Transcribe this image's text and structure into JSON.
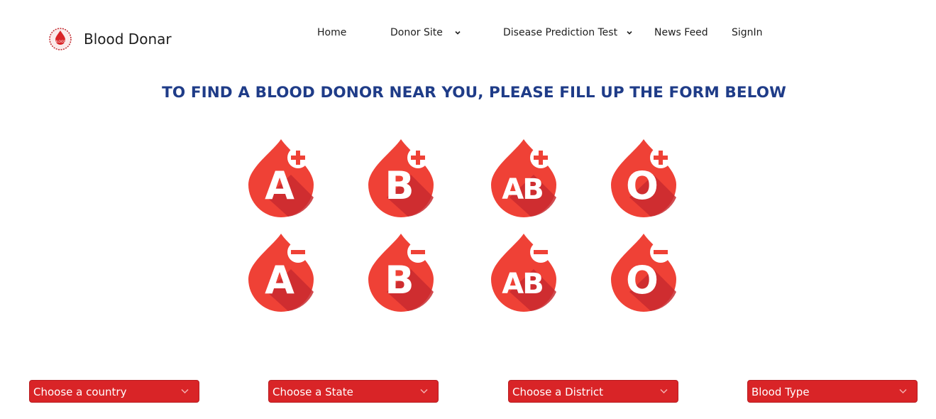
{
  "brand": {
    "name": "Blood Donar",
    "logo_icon": "blood-drop-logo-icon",
    "logo_text": "BLOOD"
  },
  "nav": {
    "home": "Home",
    "donor_site": "Donor Site",
    "disease_prediction": "Disease Prediction Test",
    "news_feed": "News Feed",
    "signin": "SignIn"
  },
  "headline": "TO FIND A BLOOD DONOR NEAR YOU, PLEASE FILL UP THE FORM BELOW",
  "blood_groups": [
    {
      "label": "A",
      "sign": "+"
    },
    {
      "label": "B",
      "sign": "+"
    },
    {
      "label": "AB",
      "sign": "+"
    },
    {
      "label": "O",
      "sign": "+"
    },
    {
      "label": "A",
      "sign": "-"
    },
    {
      "label": "B",
      "sign": "-"
    },
    {
      "label": "AB",
      "sign": "-"
    },
    {
      "label": "O",
      "sign": "-"
    }
  ],
  "filters": {
    "country": "Choose a country",
    "state": "Choose a State",
    "district": "Choose a District",
    "blood_type": "Blood Type"
  },
  "colors": {
    "drop_red": "#ef4136",
    "drop_shadow": "#c92a2f",
    "select_red": "#d92427",
    "headline_blue": "#1f3c88"
  }
}
